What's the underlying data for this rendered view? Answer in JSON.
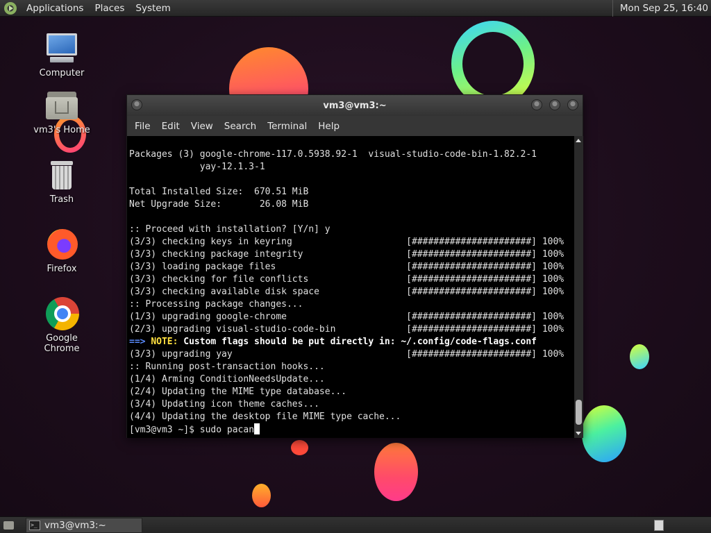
{
  "top_panel": {
    "menus": [
      "Applications",
      "Places",
      "System"
    ],
    "clock": "Mon Sep 25, 16:40"
  },
  "desktop_icons": [
    {
      "label": "Computer",
      "icon": "computer-icon"
    },
    {
      "label": "vm3's Home",
      "icon": "home-folder-icon"
    },
    {
      "label": "Trash",
      "icon": "trash-icon"
    },
    {
      "label": "Firefox",
      "icon": "firefox-icon"
    },
    {
      "label": "Google Chrome",
      "icon": "chrome-icon"
    }
  ],
  "terminal": {
    "title": "vm3@vm3:~",
    "menu": [
      "File",
      "Edit",
      "View",
      "Search",
      "Terminal",
      "Help"
    ],
    "lines": [
      "Packages (3) google-chrome-117.0.5938.92-1  visual-studio-code-bin-1.82.2-1",
      "             yay-12.1.3-1",
      "",
      "Total Installed Size:  670.51 MiB",
      "Net Upgrade Size:       26.08 MiB",
      "",
      ":: Proceed with installation? [Y/n] y",
      "(3/3) checking keys in keyring                     [######################] 100%",
      "(3/3) checking package integrity                   [######################] 100%",
      "(3/3) loading package files                        [######################] 100%",
      "(3/3) checking for file conflicts                  [######################] 100%",
      "(3/3) checking available disk space                [######################] 100%",
      ":: Processing package changes...",
      "(1/3) upgrading google-chrome                      [######################] 100%",
      "(2/3) upgrading visual-studio-code-bin             [######################] 100%"
    ],
    "note_arrow": "==>",
    "note_keyword": "NOTE:",
    "note_text": " Custom flags should be put directly in: ~/.config/code-flags.conf",
    "lines_after": [
      "(3/3) upgrading yay                                [######################] 100%",
      ":: Running post-transaction hooks...",
      "(1/4) Arming ConditionNeedsUpdate...",
      "(2/4) Updating the MIME type database...",
      "(3/4) Updating icon theme caches...",
      "(4/4) Updating the desktop file MIME type cache..."
    ],
    "prompt": "[vm3@vm3 ~]$ ",
    "command": "sudo pacan"
  },
  "bottom_panel": {
    "task_label": "vm3@vm3:~"
  }
}
